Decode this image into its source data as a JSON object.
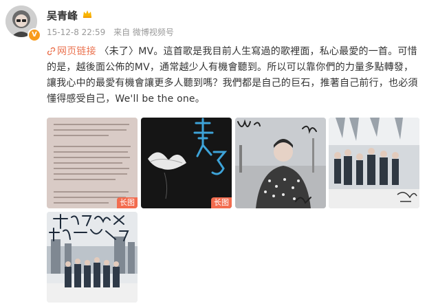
{
  "user": {
    "name": "吴青峰",
    "verified_badge": "V"
  },
  "meta": {
    "timestamp": "15-12-8 22:59",
    "source": "来自 微博视频号"
  },
  "post": {
    "link_text": "网页链接",
    "text": "〈未了〉MV。這首歌是我目前人生寫過的歌裡面，私心最愛的一首。可惜的是，越後面公佈的MV，通常越少人有機會聽到。所以可以靠你們的力量多點轉發，讓我心中的最愛有機會讓更多人聽到嗎？我們都是自己的巨石，推著自己前行，也必須懂得感受自己，We'll be the one。"
  },
  "images": [
    {
      "badge": "长图"
    },
    {
      "badge": "长图"
    },
    {
      "badge": ""
    },
    {
      "badge": ""
    },
    {
      "badge": ""
    }
  ],
  "colors": {
    "link": "#eb7350",
    "badge": "#f26c4f",
    "verified": "#f89b1c"
  }
}
